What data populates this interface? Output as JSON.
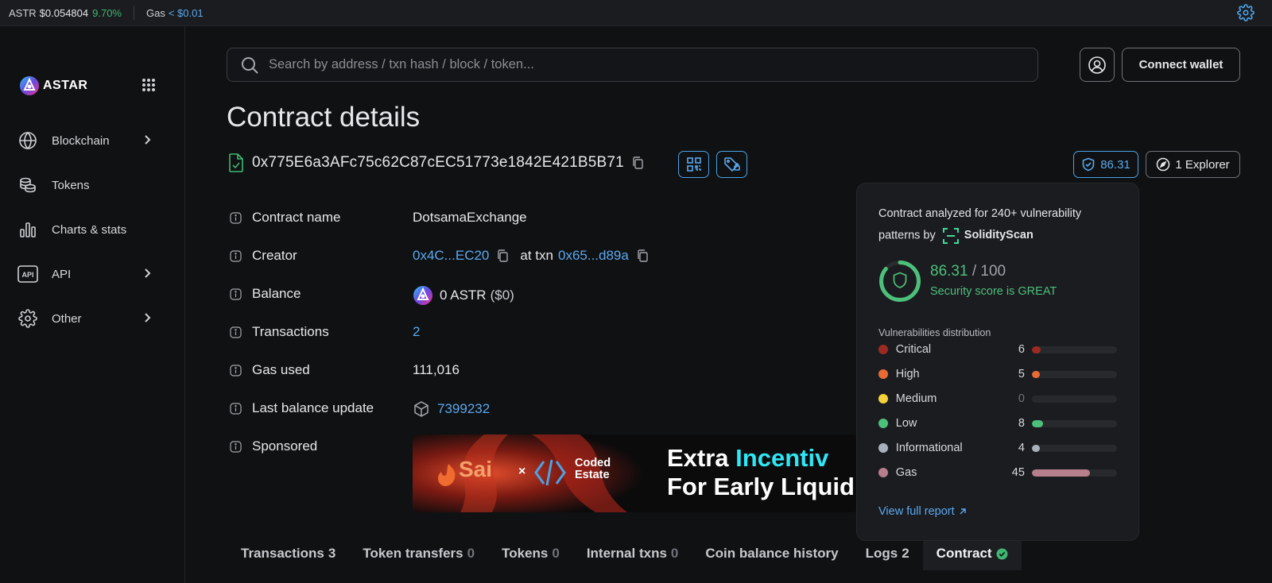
{
  "topbar": {
    "token_symbol": "ASTR",
    "token_price": "$0.054804",
    "price_change": "9.70%",
    "gas_label": "Gas",
    "gas_value": "< $0.01"
  },
  "brand": {
    "name": "ASTAR"
  },
  "sidebar": {
    "items": [
      {
        "label": "Blockchain",
        "icon": "globe-icon",
        "has_submenu": true
      },
      {
        "label": "Tokens",
        "icon": "coins-icon",
        "has_submenu": false
      },
      {
        "label": "Charts & stats",
        "icon": "bar-chart-icon",
        "has_submenu": false
      },
      {
        "label": "API",
        "icon": "api-icon",
        "has_submenu": true
      },
      {
        "label": "Other",
        "icon": "gear-icon",
        "has_submenu": true
      }
    ]
  },
  "header": {
    "search_placeholder": "Search by address / txn hash / block / token...",
    "connect_label": "Connect wallet"
  },
  "page": {
    "title": "Contract details",
    "address": "0x775E6a3AFc75c62C87cEC51773e1842E421B5B71",
    "security_score_badge": "86.31",
    "explorer_label": "1 Explorer"
  },
  "details": {
    "contract_name_label": "Contract name",
    "contract_name_value": "DotsamaExchange",
    "creator_label": "Creator",
    "creator_address": "0x4C...EC20",
    "creator_at_txn": "at txn",
    "creator_txn": "0x65...d89a",
    "balance_label": "Balance",
    "balance_value": "0 ASTR",
    "balance_usd": "($0)",
    "transactions_label": "Transactions",
    "transactions_value": "2",
    "gas_used_label": "Gas used",
    "gas_used_value": "111,016",
    "last_balance_label": "Last balance update",
    "last_balance_value": "7399232",
    "sponsored_label": "Sponsored"
  },
  "banner": {
    "brand_left": "Sai",
    "times": "×",
    "brand_right_1": "Coded",
    "brand_right_2": "Estate",
    "headline_1a": "Extra ",
    "headline_1b": "Incentiv",
    "headline_2": "For Early Liquid"
  },
  "tabs": [
    {
      "label": "Transactions",
      "count": "3"
    },
    {
      "label": "Token transfers",
      "count": "0"
    },
    {
      "label": "Tokens",
      "count": "0"
    },
    {
      "label": "Internal txns",
      "count": "0"
    },
    {
      "label": "Coin balance history",
      "count": ""
    },
    {
      "label": "Logs",
      "count": "2"
    },
    {
      "label": "Contract",
      "count": ""
    }
  ],
  "popup": {
    "intro_1": "Contract analyzed for 240+ vulnerability",
    "intro_2": "patterns by",
    "provider": "SolidityScan",
    "score": "86.31",
    "score_max": "/ 100",
    "score_text": "Security score is GREAT",
    "score_fraction": 0.8631,
    "distribution_title": "Vulnerabilities distribution",
    "vulnerabilities": [
      {
        "name": "Critical",
        "count": "6",
        "color": "#9b2a22",
        "fraction": 0.1
      },
      {
        "name": "High",
        "count": "5",
        "color": "#e86b35",
        "fraction": 0.09
      },
      {
        "name": "Medium",
        "count": "0",
        "color": "#f3d23a",
        "fraction": 0
      },
      {
        "name": "Low",
        "count": "8",
        "color": "#4cc07a",
        "fraction": 0.13
      },
      {
        "name": "Informational",
        "count": "4",
        "color": "#a9b0bd",
        "fraction": 0.07
      },
      {
        "name": "Gas",
        "count": "45",
        "color": "#b77e8c",
        "fraction": 0.67
      }
    ],
    "full_report_label": "View full report"
  },
  "colors": {
    "accent": "#5aa9f0",
    "positive": "#3fb772",
    "background": "#101112"
  }
}
